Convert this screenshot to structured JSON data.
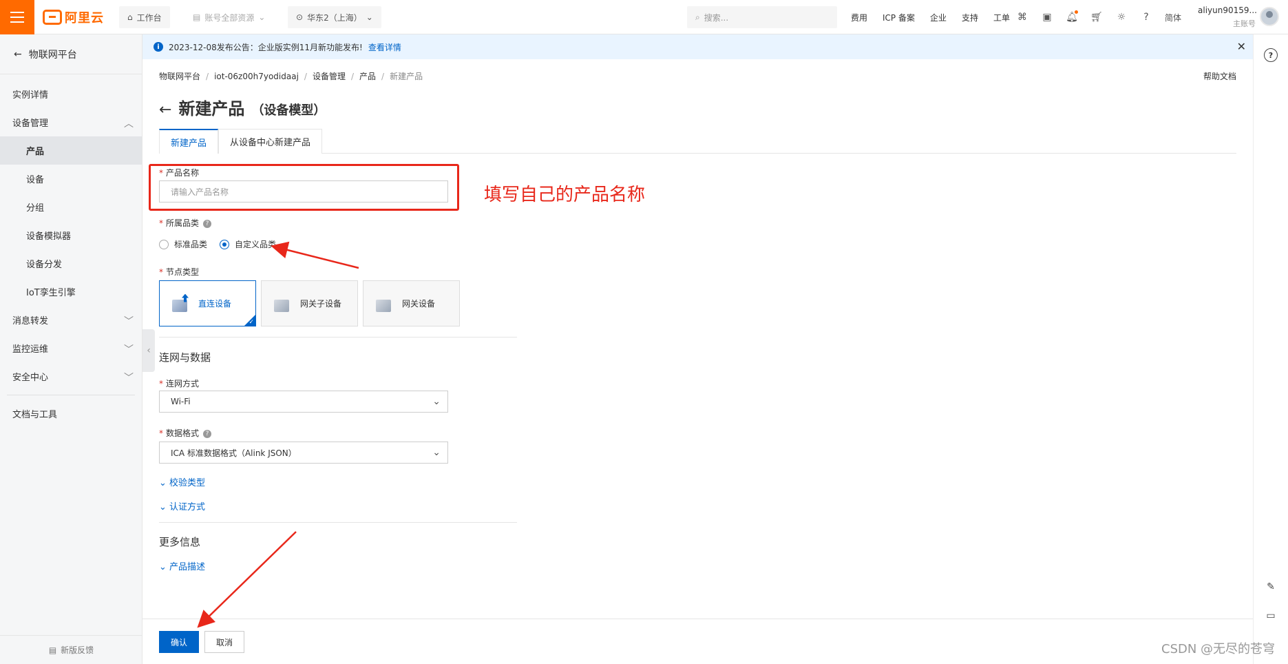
{
  "topbar": {
    "logo": "阿里云",
    "workbench": "工作台",
    "resources": "账号全部资源",
    "region": "华东2（上海）",
    "search_placeholder": "搜索...",
    "links": [
      "费用",
      "ICP 备案",
      "企业",
      "支持",
      "工单"
    ],
    "lang": "简体",
    "user_name": "aliyun90159...",
    "user_sub": "主账号"
  },
  "sidebar": {
    "back_label": "物联网平台",
    "items": [
      {
        "label": "实例详情"
      },
      {
        "label": "设备管理"
      },
      {
        "label": "产品"
      },
      {
        "label": "设备"
      },
      {
        "label": "分组"
      },
      {
        "label": "设备模拟器"
      },
      {
        "label": "设备分发"
      },
      {
        "label": "IoT孪生引擎"
      },
      {
        "label": "消息转发"
      },
      {
        "label": "监控运维"
      },
      {
        "label": "安全中心"
      },
      {
        "label": "文档与工具"
      }
    ],
    "feedback": "新版反馈"
  },
  "notice": {
    "text": "2023-12-08发布公告：企业版实例11月新功能发布!",
    "link": "查看详情"
  },
  "breadcrumb": [
    "物联网平台",
    "iot-06z00h7yodidaaj",
    "设备管理",
    "产品",
    "新建产品"
  ],
  "help_doc": "帮助文档",
  "page": {
    "title": "新建产品",
    "subtitle": "（设备模型）"
  },
  "tabs": [
    "新建产品",
    "从设备中心新建产品"
  ],
  "form": {
    "product_name_label": "产品名称",
    "product_name_placeholder": "请输入产品名称",
    "category_label": "所属品类",
    "category_options": [
      "标准品类",
      "自定义品类"
    ],
    "node_type_label": "节点类型",
    "node_types": [
      "直连设备",
      "网关子设备",
      "网关设备"
    ],
    "network_section": "连网与数据",
    "network_label": "连网方式",
    "network_value": "Wi-Fi",
    "data_format_label": "数据格式",
    "data_format_value": "ICA 标准数据格式（Alink JSON）",
    "verify_type": "校验类型",
    "auth_method": "认证方式",
    "more_section": "更多信息",
    "product_desc": "产品描述"
  },
  "annotation": "填写自己的产品名称",
  "footer": {
    "confirm": "确认",
    "cancel": "取消"
  },
  "watermark": "CSDN @无尽的苍穹",
  "colors": {
    "brand": "#ff6a00",
    "primary": "#0064c8",
    "annotation": "#e8271a"
  }
}
